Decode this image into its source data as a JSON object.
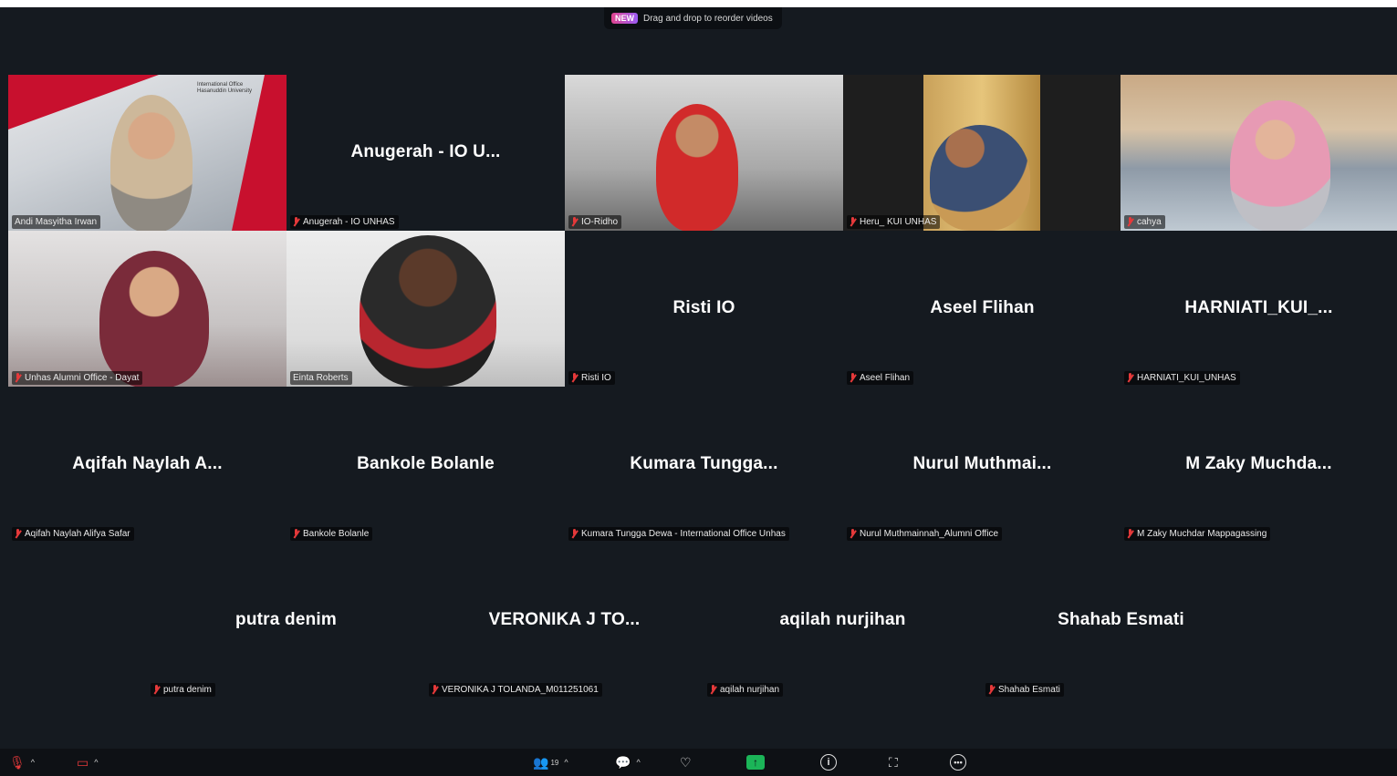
{
  "notice": {
    "badge": "NEW",
    "text": "Drag and drop to reorder videos"
  },
  "tiles": [
    {
      "big": "",
      "label": "Andi Masyitha Irwan"
    },
    {
      "big": "Anugerah - IO U...",
      "label": "Anugerah - IO UNHAS"
    },
    {
      "big": "",
      "label": "IO-Ridho"
    },
    {
      "big": "",
      "label": "Heru_ KUI UNHAS"
    },
    {
      "big": "",
      "label": "cahya"
    },
    {
      "big": "",
      "label": "Unhas Alumni Office - Dayat"
    },
    {
      "big": "",
      "label": "Einta Roberts"
    },
    {
      "big": "Risti IO",
      "label": "Risti IO"
    },
    {
      "big": "Aseel Flihan",
      "label": "Aseel Flihan"
    },
    {
      "big": "HARNIATI_KUI_...",
      "label": "HARNIATI_KUI_UNHAS"
    },
    {
      "big": "Aqifah Naylah A...",
      "label": "Aqifah Naylah Alifya Safar"
    },
    {
      "big": "Bankole Bolanle",
      "label": "Bankole Bolanle"
    },
    {
      "big": "Kumara Tungga...",
      "label": "Kumara Tungga Dewa - International Office Unhas"
    },
    {
      "big": "Nurul Muthmai...",
      "label": "Nurul Muthmainnah_Alumni Office"
    },
    {
      "big": "M Zaky Muchda...",
      "label": "M Zaky Muchdar Mappagassing"
    },
    {
      "big": "putra denim",
      "label": "putra denim"
    },
    {
      "big": "VERONIKA J TO...",
      "label": "VERONIKA J TOLANDA_M011251061"
    },
    {
      "big": "aqilah nurjihan",
      "label": "aqilah nurjihan"
    },
    {
      "big": "Shahab Esmati",
      "label": "Shahab Esmati"
    }
  ],
  "logo_text": "International Office Hasanuddin University",
  "toolbar": {
    "participants_count": "19",
    "icons": [
      "mic-muted-icon",
      "camera-off-icon",
      "participants-icon",
      "chat-icon",
      "reactions-icon",
      "share-screen-icon",
      "info-icon",
      "apps-icon",
      "more-icon"
    ]
  },
  "colors": {
    "speaking_border": "#3fcf7a",
    "muted_mic": "#e5393a",
    "share_green": "#1bb558"
  }
}
